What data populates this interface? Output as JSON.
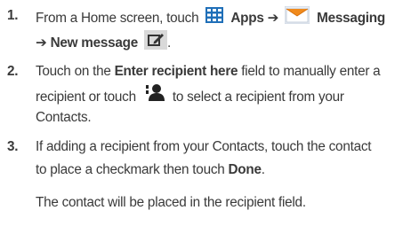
{
  "steps": [
    {
      "number": "1.",
      "part_a": "From a Home screen, touch",
      "apps": "Apps",
      "arrow1": "➔",
      "messaging": "Messaging",
      "arrow2": "➔",
      "new_message": "New message",
      "period": "."
    },
    {
      "number": "2.",
      "part_a": "Touch on the",
      "enter_field": "Enter recipient here",
      "part_b": "field to manually enter a",
      "part_c": "recipient or touch",
      "part_d": "to select a recipient from your",
      "part_e": "Contacts."
    },
    {
      "number": "3.",
      "part_a": "If adding a recipient from your Contacts, touch the contact",
      "part_b": "to place a checkmark then touch",
      "done": "Done",
      "period": ".",
      "note": "The contact will be placed in the recipient field."
    }
  ],
  "colors": {
    "text": "#3a3a3a",
    "apps_icon_blue": "#1f6fb8",
    "messaging_icon_orange": "#f08a1c"
  },
  "icons": {
    "apps": "apps-grid-icon",
    "messaging": "messaging-envelope-icon",
    "new_message": "compose-icon",
    "contacts": "contact-person-icon"
  }
}
